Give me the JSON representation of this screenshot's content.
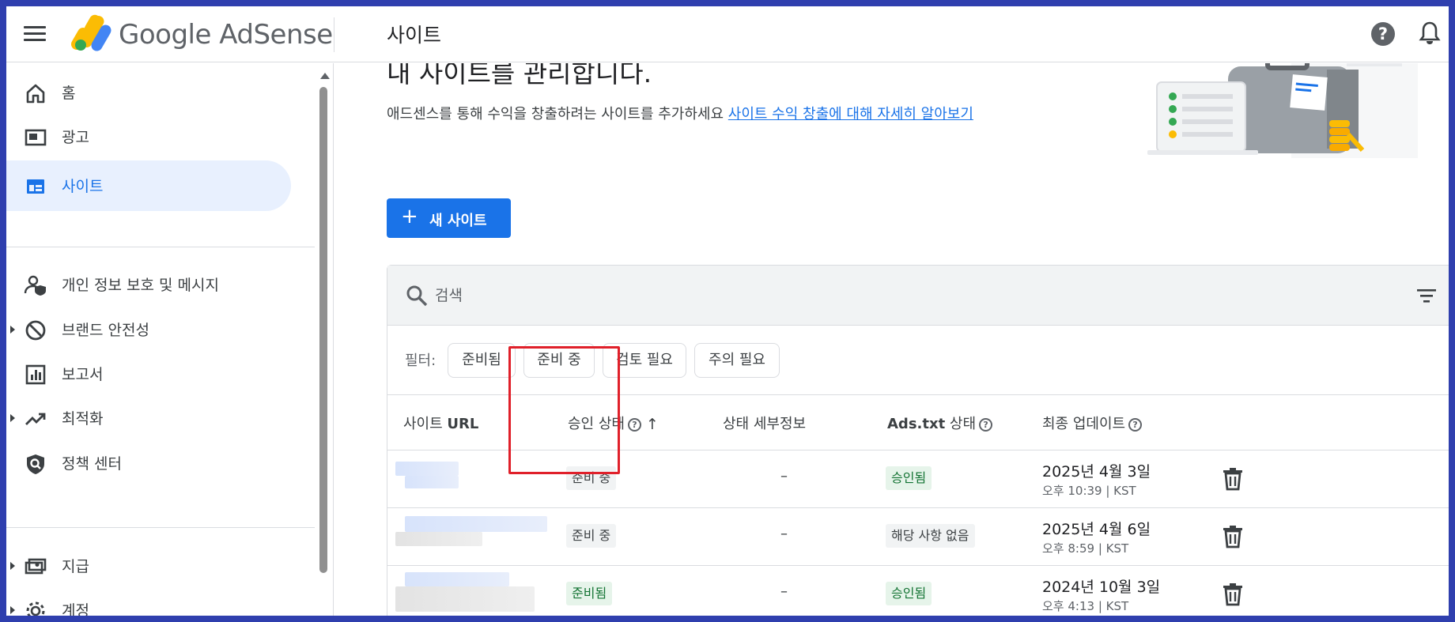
{
  "topbar": {
    "brand": "Google AdSense",
    "page_title": "사이트"
  },
  "sidebar": {
    "items": [
      {
        "label": "홈",
        "icon": "home-icon"
      },
      {
        "label": "광고",
        "icon": "ads-icon"
      },
      {
        "label": "사이트",
        "icon": "sites-icon",
        "active": true
      },
      {
        "label": "개인 정보 보호 및 메시지",
        "icon": "privacy-icon"
      },
      {
        "label": "브랜드 안전성",
        "icon": "block-icon"
      },
      {
        "label": "보고서",
        "icon": "report-icon"
      },
      {
        "label": "최적화",
        "icon": "trending-icon"
      },
      {
        "label": "정책 센터",
        "icon": "policy-icon"
      },
      {
        "label": "지급",
        "icon": "payments-icon"
      },
      {
        "label": "계정",
        "icon": "gear-icon"
      }
    ]
  },
  "main": {
    "heading": "내 사이트를 관리합니다.",
    "subtitle": "애드센스를 통해 수익을 창출하려는 사이트를 추가하세요",
    "subtitle_link": "사이트 수익 창출에 대해 자세히 알아보기",
    "new_site_button": "새 사이트",
    "search_placeholder": "검색",
    "filter_label": "필터:",
    "filter_chips": [
      "준비됨",
      "준비 중",
      "검토 필요",
      "주의 필요"
    ],
    "columns": {
      "site_url_prefix": "사이트",
      "site_url_suffix": "URL",
      "approval": "승인 상태",
      "detail": "상태 세부정보",
      "ads_txt_prefix": "Ads.txt",
      "ads_txt_suffix": "상태",
      "updated": "최종 업데이트"
    },
    "rows": [
      {
        "approval": "준비 중",
        "detail": "–",
        "ads_txt": "승인됨",
        "date": "2025년 4월 3일",
        "time": "오후 10:39 | KST"
      },
      {
        "approval": "준비 중",
        "detail": "–",
        "ads_txt": "해당 사항 없음",
        "date": "2025년 4월 6일",
        "time": "오후 8:59 | KST"
      },
      {
        "approval": "준비됨",
        "detail": "–",
        "ads_txt": "승인됨",
        "date": "2024년 10월 3일",
        "time": "오후 4:13 | KST"
      }
    ]
  },
  "colors": {
    "accent": "#1a73e8",
    "active_bg": "#e8f0fe",
    "ready_green": "#137333",
    "highlight_red": "#e0202a",
    "outer_border": "#2f3fae"
  }
}
